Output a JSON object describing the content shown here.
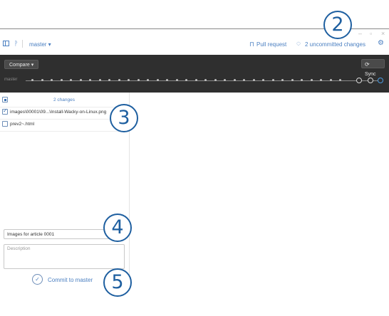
{
  "toolbar": {
    "branch_label": "master ▾",
    "pull_request_label": "Pull request",
    "uncommitted_label": "2 uncommitted changes"
  },
  "header": {
    "compare_label": "Compare ▾",
    "sync_label": "Sync",
    "branch_name": "master"
  },
  "changes": {
    "count_label": "2 changes",
    "files": [
      {
        "path": "images\\00001\\09...\\Install-Wacky-on-Linux.png",
        "checked": true
      },
      {
        "path": "prev2~.html",
        "checked": false
      }
    ]
  },
  "commit": {
    "summary_value": "Images for article 0001",
    "description_placeholder": "Description",
    "button_label": "Commit to master"
  },
  "callouts": [
    "2",
    "3",
    "4",
    "5"
  ],
  "colors": {
    "accent": "#4a7fc1",
    "callout": "#1e5fa0",
    "header_bg": "#2f2f2f"
  }
}
